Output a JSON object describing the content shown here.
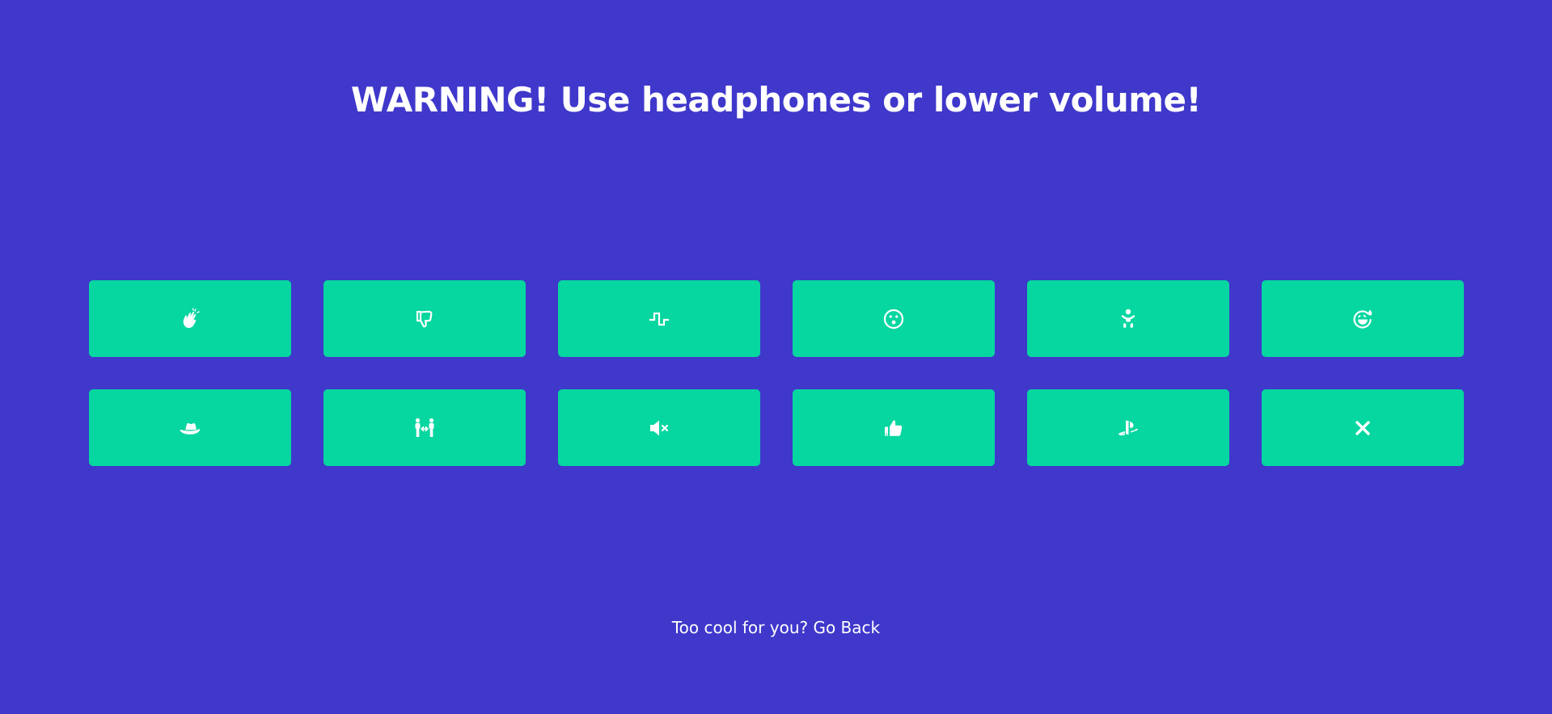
{
  "page": {
    "title": "WARNING! Use headphones or lower volume!",
    "background_color": "#3f38cb",
    "button_color": "#06d6a0"
  },
  "sound_buttons": [
    {
      "icon": "hands-clapping-icon"
    },
    {
      "icon": "thumbs-down-icon"
    },
    {
      "icon": "square-wave-icon"
    },
    {
      "icon": "surprised-face-icon"
    },
    {
      "icon": "baby-icon"
    },
    {
      "icon": "crying-laughing-face-icon"
    },
    {
      "icon": "cowboy-hat-icon"
    },
    {
      "icon": "people-arrows-icon"
    },
    {
      "icon": "volume-mute-icon"
    },
    {
      "icon": "thumbs-up-icon"
    },
    {
      "icon": "playstation-icon"
    },
    {
      "icon": "close-x-icon"
    }
  ],
  "footer": {
    "prefix": "Too cool for you? ",
    "link_label": "Go Back"
  }
}
